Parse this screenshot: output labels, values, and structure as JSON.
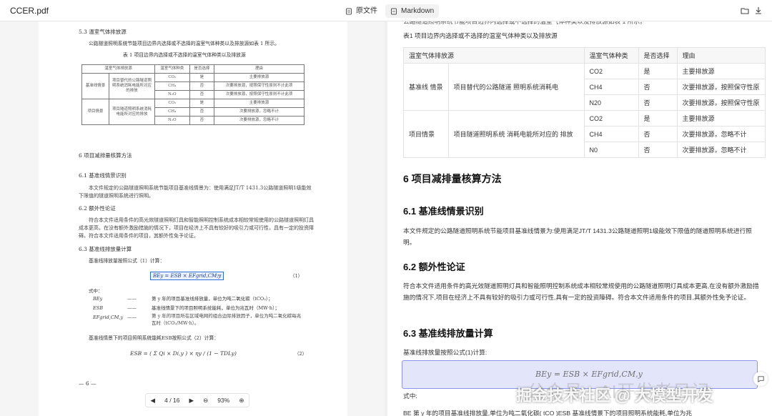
{
  "titlebar": {
    "filename": "CCER.pdf",
    "tab_raw": "原文件",
    "tab_md": "Markdown",
    "icon_open": "folder-open-icon",
    "icon_download": "download-icon"
  },
  "pdf": {
    "sec53": "5.3  温室气体排放源",
    "sec53_text": "公路隧道照明系统节能项目边界内选择或不选择的温室气体种类以及排放源如表 1 所示。",
    "table_caption": "表 1  项目边界内选择或不选择的温室气体种类以及排放源",
    "table_head": [
      "温室气体排放源",
      "温室气体种类",
      "是否选择",
      "理由"
    ],
    "rows": [
      {
        "group": "基准线情景",
        "source": "项目替代的公路隧道照明系统消耗电能所对应的排放",
        "gas": "CO₂",
        "sel": "是",
        "reason": "主要排放源"
      },
      {
        "gas": "CH₄",
        "sel": "否",
        "reason": "次要排放源，按照保守性原则不计此项"
      },
      {
        "gas": "N₂O",
        "sel": "否",
        "reason": "次要排放源，按照保守性原则不计此项"
      },
      {
        "group": "项目情景",
        "source": "项目隧道照明系统消耗电能所对应的排放",
        "gas": "CO₂",
        "sel": "是",
        "reason": "主要排放源"
      },
      {
        "gas": "CH₄",
        "sel": "否",
        "reason": "次要排放源，忽略不计"
      },
      {
        "gas": "N₂O",
        "sel": "否",
        "reason": "次要排放源，忽略不计"
      }
    ],
    "sec6": "6  项目减排量核算方法",
    "sec61": "6.1  基准线情景识别",
    "sec61_text": "本文件规定的公路隧道照明系统节能项目基准线情景为：使用满足JT/T 1431.3公路隧道照明1级能效下限值的隧道照明系统进行照明。",
    "sec62": "6.2  额外性论证",
    "sec62_text": "符合本文件适用条件的高光效隧道照明灯具和智能照明控制系统成本相较常规使用的公路隧道照明灯具成本更高，在没有额外激励措施的情况下，项目在经济上不具有较好的吸引力或可行性，具有一定的投资障碍。符合本文件适用条件的项目，其额外性免予论证。",
    "sec63": "6.3  基准线排放量计算",
    "sec63_text": "基准线排放量按照公式（1）计算：",
    "formula1": "BEy = ESB × EFgrid,CM,y",
    "formula1_no": "（1）",
    "where": "式中：",
    "defs": [
      {
        "sym": "BEy",
        "dash": "——",
        "text": "第 y 年的项目基准线排放量，单位为吨二氧化碳（tCO₂）；"
      },
      {
        "sym": "ESB",
        "dash": "——",
        "text": "基准线情景下的项目照明系统能耗，单位为兆瓦时（MW·h）；"
      },
      {
        "sym": "EFgrid,CM,y",
        "dash": "——",
        "text": "第 y 年的项目所在区域电网的组合边际排放因子，单位为吨二氧化碳每兆瓦时（tCO₂/MW·h）。"
      }
    ],
    "sec63_text2": "基准线情景下的项目照明系统能耗ESB按照公式（2）计算：",
    "formula2": "ESB = ( Σ Qi × Di,y ) × ηy / (1 − TDLy)",
    "formula2_no": "（2）",
    "page_no": "— 6 —",
    "pager": {
      "current": "4",
      "sep": "/",
      "total": "16",
      "zoom": "93%"
    }
  },
  "md": {
    "top_cut": "公路隧道照明系统节能项目边界内选择或不选择的温室气体种类以及排放源如表 1 所示。",
    "caption": "表1 项目边界内选择或不选择的温室气体种类以及排放源",
    "head": [
      "温室气体排放源",
      "温室气体种类",
      "是否选择",
      "理由"
    ],
    "g1": "基准线 情景",
    "g1_src": "项目替代的公路隧道 照明系统消耗电",
    "g2": "项目情景",
    "g2_src": "项目隧道照明系统 消耗电能所对应的 排放",
    "rows": [
      {
        "gas": "CO2",
        "sel": "是",
        "reason": "主要排放源"
      },
      {
        "gas": "CH4",
        "sel": "否",
        "reason": "次要排放源，按照保守性原"
      },
      {
        "gas": "N20",
        "sel": "否",
        "reason": "次要排放源，按照保守性原"
      },
      {
        "gas": "CO2",
        "sel": "是",
        "reason": "主要排放源"
      },
      {
        "gas": "CH4",
        "sel": "否",
        "reason": "次要排放源，忽略不计"
      },
      {
        "gas": "N0",
        "sel": "否",
        "reason": "次要排放源，忽略不计"
      }
    ],
    "h6": "6 项目减排量核算方法",
    "h61": "6.1 基准线情景识别",
    "p61": "本文件规定的公路隧道照明系统节能项目基准线情景为:使用满足JT/T 1431.3公路隧道照明1级能效下限值的隧道照明系统进行照明。",
    "h62": "6.2 额外性论证",
    "p62": "符合本文件适用条件的高光效隧道照明灯具和智能照明控制系统成本相较常规使用的公路隧道照明灯具成本更高,在没有额外激励措施的情况下,项目在经济上不具有较好的吸引力或可行性,具有一定的投资障碍。符合本文件适用条件的项目,其额外性免予论证。",
    "h63": "6.3 基准线排放量计算",
    "p63": "基准线排放量按照公式(1)计算:",
    "formula": "BEy = ESB × EFgrid,CM,y",
    "where": "式中:",
    "bottom_cut": "BE  第 y 年的项目基准线排放量,单位为吨二氧化碳( tCO )ESB 基准线情景下的项目照明系统能耗,单位为兆",
    "watermark": "掘金技术社区 @ 大模型开发",
    "watermark2": "公众号 · AI开发者日记"
  }
}
